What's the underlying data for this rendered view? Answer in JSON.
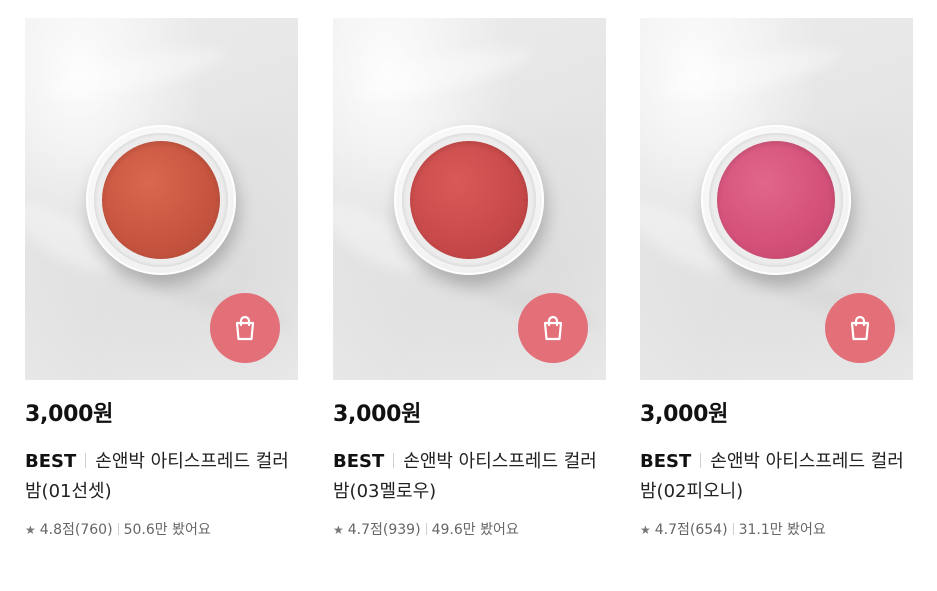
{
  "products": [
    {
      "price": "3,000원",
      "badge": "BEST",
      "name": "손앤박 아티스프레드 컬러밤(01선셋)",
      "rating": "4.8점(760)",
      "views": "50.6만 봤어요",
      "balm_color": "#c85540"
    },
    {
      "price": "3,000원",
      "badge": "BEST",
      "name": "손앤박 아티스프레드 컬러밤(03멜로우)",
      "rating": "4.7점(939)",
      "views": "49.6만 봤어요",
      "balm_color": "#c94a4a"
    },
    {
      "price": "3,000원",
      "badge": "BEST",
      "name": "손앤박 아티스프레드 컬러밤(02피오니)",
      "rating": "4.7점(654)",
      "views": "31.1만 봤어요",
      "balm_color": "#d5527a"
    }
  ],
  "star_glyph": "★",
  "icons": {
    "cart": "shopping-bag-icon"
  },
  "colors": {
    "cart_button": "#e36f79",
    "price_text": "#111111",
    "meta_text": "#666666"
  }
}
